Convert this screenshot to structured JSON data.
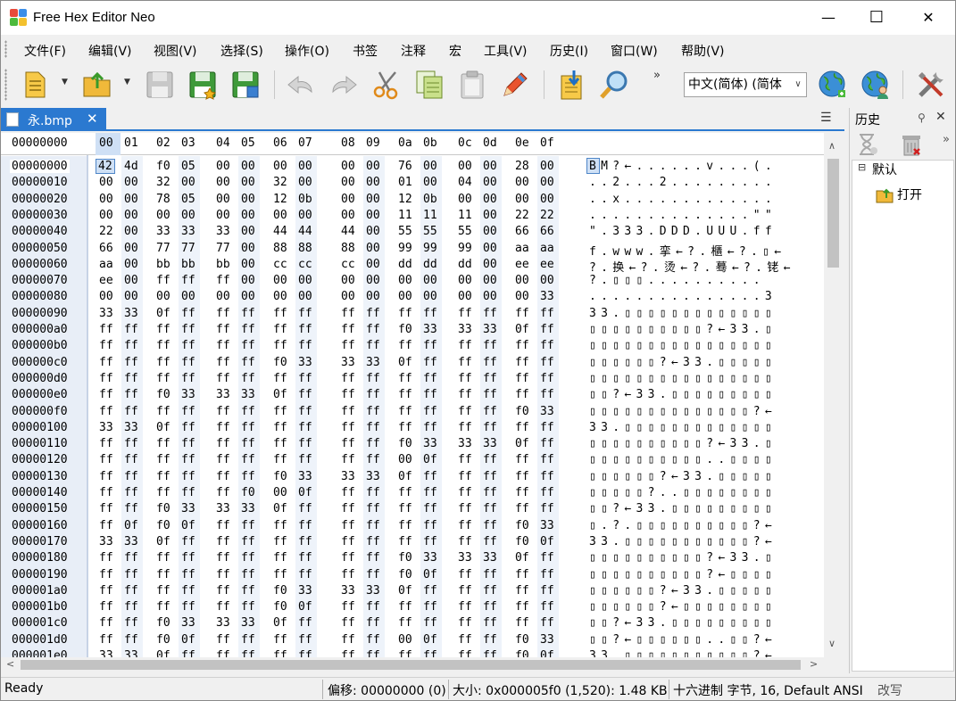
{
  "window": {
    "title": "Free Hex Editor Neo",
    "minimize": "—",
    "maximize": "☐",
    "close": "✕"
  },
  "menu": [
    "文件(F)",
    "编辑(V)",
    "视图(V)",
    "选择(S)",
    "操作(O)",
    "书签",
    "注释",
    "宏",
    "工具(V)",
    "历史(I)",
    "窗口(W)",
    "帮助(V)"
  ],
  "toolbar": {
    "icons": [
      "new-file-icon",
      "open-folder-icon",
      "save-disabled-icon",
      "save-as-icon",
      "save-all-icon",
      "undo-icon",
      "redo-icon",
      "cut-icon",
      "copy-icon",
      "paste-icon",
      "edit-icon",
      "import-icon",
      "find-icon",
      "globe-icon",
      "globe-user-icon",
      "tools-icon"
    ],
    "language": "中文(简体) (简体",
    "overflow": "»"
  },
  "tab": {
    "filename": "永.bmp",
    "close": "✕",
    "menu": "☰"
  },
  "hex": {
    "header_offset": "00000000",
    "columns": [
      "00",
      "01",
      "02",
      "03",
      "04",
      "05",
      "06",
      "07",
      "08",
      "09",
      "0a",
      "0b",
      "0c",
      "0d",
      "0e",
      "0f"
    ],
    "rows": [
      {
        "offset": "00000000",
        "bytes": [
          "42",
          "4d",
          "f0",
          "05",
          "00",
          "00",
          "00",
          "00",
          "00",
          "00",
          "76",
          "00",
          "00",
          "00",
          "28",
          "00"
        ],
        "text": "BM?←......v...(."
      },
      {
        "offset": "00000010",
        "bytes": [
          "00",
          "00",
          "32",
          "00",
          "00",
          "00",
          "32",
          "00",
          "00",
          "00",
          "01",
          "00",
          "04",
          "00",
          "00",
          "00"
        ],
        "text": "..2...2........."
      },
      {
        "offset": "00000020",
        "bytes": [
          "00",
          "00",
          "78",
          "05",
          "00",
          "00",
          "12",
          "0b",
          "00",
          "00",
          "12",
          "0b",
          "00",
          "00",
          "00",
          "00"
        ],
        "text": "..x............."
      },
      {
        "offset": "00000030",
        "bytes": [
          "00",
          "00",
          "00",
          "00",
          "00",
          "00",
          "00",
          "00",
          "00",
          "00",
          "11",
          "11",
          "11",
          "00",
          "22",
          "22"
        ],
        "text": "..............\"\""
      },
      {
        "offset": "00000040",
        "bytes": [
          "22",
          "00",
          "33",
          "33",
          "33",
          "00",
          "44",
          "44",
          "44",
          "00",
          "55",
          "55",
          "55",
          "00",
          "66",
          "66"
        ],
        "text": "\".333.DDD.UUU.ff"
      },
      {
        "offset": "00000050",
        "bytes": [
          "66",
          "00",
          "77",
          "77",
          "77",
          "00",
          "88",
          "88",
          "88",
          "00",
          "99",
          "99",
          "99",
          "00",
          "aa",
          "aa"
        ],
        "text": "f.www.挛←?.櫃←?.▯←"
      },
      {
        "offset": "00000060",
        "bytes": [
          "aa",
          "00",
          "bb",
          "bb",
          "bb",
          "00",
          "cc",
          "cc",
          "cc",
          "00",
          "dd",
          "dd",
          "dd",
          "00",
          "ee",
          "ee"
        ],
        "text": "?.换←?.烫←?.蓦←?.铑←"
      },
      {
        "offset": "00000070",
        "bytes": [
          "ee",
          "00",
          "ff",
          "ff",
          "ff",
          "00",
          "00",
          "00",
          "00",
          "00",
          "00",
          "00",
          "00",
          "00",
          "00",
          "00"
        ],
        "text": "?.▯▯▯.........."
      },
      {
        "offset": "00000080",
        "bytes": [
          "00",
          "00",
          "00",
          "00",
          "00",
          "00",
          "00",
          "00",
          "00",
          "00",
          "00",
          "00",
          "00",
          "00",
          "00",
          "33"
        ],
        "text": "...............3"
      },
      {
        "offset": "00000090",
        "bytes": [
          "33",
          "33",
          "0f",
          "ff",
          "ff",
          "ff",
          "ff",
          "ff",
          "ff",
          "ff",
          "ff",
          "ff",
          "ff",
          "ff",
          "ff",
          "ff"
        ],
        "text": "33.▯▯▯▯▯▯▯▯▯▯▯▯▯"
      },
      {
        "offset": "000000a0",
        "bytes": [
          "ff",
          "ff",
          "ff",
          "ff",
          "ff",
          "ff",
          "ff",
          "ff",
          "ff",
          "ff",
          "f0",
          "33",
          "33",
          "33",
          "0f",
          "ff"
        ],
        "text": "▯▯▯▯▯▯▯▯▯▯?←33.▯"
      },
      {
        "offset": "000000b0",
        "bytes": [
          "ff",
          "ff",
          "ff",
          "ff",
          "ff",
          "ff",
          "ff",
          "ff",
          "ff",
          "ff",
          "ff",
          "ff",
          "ff",
          "ff",
          "ff",
          "ff"
        ],
        "text": "▯▯▯▯▯▯▯▯▯▯▯▯▯▯▯▯"
      },
      {
        "offset": "000000c0",
        "bytes": [
          "ff",
          "ff",
          "ff",
          "ff",
          "ff",
          "ff",
          "f0",
          "33",
          "33",
          "33",
          "0f",
          "ff",
          "ff",
          "ff",
          "ff",
          "ff"
        ],
        "text": "▯▯▯▯▯▯?←33.▯▯▯▯▯"
      },
      {
        "offset": "000000d0",
        "bytes": [
          "ff",
          "ff",
          "ff",
          "ff",
          "ff",
          "ff",
          "ff",
          "ff",
          "ff",
          "ff",
          "ff",
          "ff",
          "ff",
          "ff",
          "ff",
          "ff"
        ],
        "text": "▯▯▯▯▯▯▯▯▯▯▯▯▯▯▯▯"
      },
      {
        "offset": "000000e0",
        "bytes": [
          "ff",
          "ff",
          "f0",
          "33",
          "33",
          "33",
          "0f",
          "ff",
          "ff",
          "ff",
          "ff",
          "ff",
          "ff",
          "ff",
          "ff",
          "ff"
        ],
        "text": "▯▯?←33.▯▯▯▯▯▯▯▯▯"
      },
      {
        "offset": "000000f0",
        "bytes": [
          "ff",
          "ff",
          "ff",
          "ff",
          "ff",
          "ff",
          "ff",
          "ff",
          "ff",
          "ff",
          "ff",
          "ff",
          "ff",
          "ff",
          "f0",
          "33"
        ],
        "text": "▯▯▯▯▯▯▯▯▯▯▯▯▯▯?←"
      },
      {
        "offset": "00000100",
        "bytes": [
          "33",
          "33",
          "0f",
          "ff",
          "ff",
          "ff",
          "ff",
          "ff",
          "ff",
          "ff",
          "ff",
          "ff",
          "ff",
          "ff",
          "ff",
          "ff"
        ],
        "text": "33.▯▯▯▯▯▯▯▯▯▯▯▯▯"
      },
      {
        "offset": "00000110",
        "bytes": [
          "ff",
          "ff",
          "ff",
          "ff",
          "ff",
          "ff",
          "ff",
          "ff",
          "ff",
          "ff",
          "f0",
          "33",
          "33",
          "33",
          "0f",
          "ff"
        ],
        "text": "▯▯▯▯▯▯▯▯▯▯?←33.▯"
      },
      {
        "offset": "00000120",
        "bytes": [
          "ff",
          "ff",
          "ff",
          "ff",
          "ff",
          "ff",
          "ff",
          "ff",
          "ff",
          "ff",
          "00",
          "0f",
          "ff",
          "ff",
          "ff",
          "ff"
        ],
        "text": "▯▯▯▯▯▯▯▯▯▯..▯▯▯▯"
      },
      {
        "offset": "00000130",
        "bytes": [
          "ff",
          "ff",
          "ff",
          "ff",
          "ff",
          "ff",
          "f0",
          "33",
          "33",
          "33",
          "0f",
          "ff",
          "ff",
          "ff",
          "ff",
          "ff"
        ],
        "text": "▯▯▯▯▯▯?←33.▯▯▯▯▯"
      },
      {
        "offset": "00000140",
        "bytes": [
          "ff",
          "ff",
          "ff",
          "ff",
          "ff",
          "f0",
          "00",
          "0f",
          "ff",
          "ff",
          "ff",
          "ff",
          "ff",
          "ff",
          "ff",
          "ff"
        ],
        "text": "▯▯▯▯▯?..▯▯▯▯▯▯▯▯"
      },
      {
        "offset": "00000150",
        "bytes": [
          "ff",
          "ff",
          "f0",
          "33",
          "33",
          "33",
          "0f",
          "ff",
          "ff",
          "ff",
          "ff",
          "ff",
          "ff",
          "ff",
          "ff",
          "ff"
        ],
        "text": "▯▯?←33.▯▯▯▯▯▯▯▯▯"
      },
      {
        "offset": "00000160",
        "bytes": [
          "ff",
          "0f",
          "f0",
          "0f",
          "ff",
          "ff",
          "ff",
          "ff",
          "ff",
          "ff",
          "ff",
          "ff",
          "ff",
          "ff",
          "f0",
          "33"
        ],
        "text": "▯.?.▯▯▯▯▯▯▯▯▯▯?←"
      },
      {
        "offset": "00000170",
        "bytes": [
          "33",
          "33",
          "0f",
          "ff",
          "ff",
          "ff",
          "ff",
          "ff",
          "ff",
          "ff",
          "ff",
          "ff",
          "ff",
          "ff",
          "f0",
          "0f"
        ],
        "text": "33.▯▯▯▯▯▯▯▯▯▯▯?←"
      },
      {
        "offset": "00000180",
        "bytes": [
          "ff",
          "ff",
          "ff",
          "ff",
          "ff",
          "ff",
          "ff",
          "ff",
          "ff",
          "ff",
          "f0",
          "33",
          "33",
          "33",
          "0f",
          "ff"
        ],
        "text": "▯▯▯▯▯▯▯▯▯▯?←33.▯"
      },
      {
        "offset": "00000190",
        "bytes": [
          "ff",
          "ff",
          "ff",
          "ff",
          "ff",
          "ff",
          "ff",
          "ff",
          "ff",
          "ff",
          "f0",
          "0f",
          "ff",
          "ff",
          "ff",
          "ff"
        ],
        "text": "▯▯▯▯▯▯▯▯▯▯?←▯▯▯▯"
      },
      {
        "offset": "000001a0",
        "bytes": [
          "ff",
          "ff",
          "ff",
          "ff",
          "ff",
          "ff",
          "f0",
          "33",
          "33",
          "33",
          "0f",
          "ff",
          "ff",
          "ff",
          "ff",
          "ff"
        ],
        "text": "▯▯▯▯▯▯?←33.▯▯▯▯▯"
      },
      {
        "offset": "000001b0",
        "bytes": [
          "ff",
          "ff",
          "ff",
          "ff",
          "ff",
          "ff",
          "f0",
          "0f",
          "ff",
          "ff",
          "ff",
          "ff",
          "ff",
          "ff",
          "ff",
          "ff"
        ],
        "text": "▯▯▯▯▯▯?←▯▯▯▯▯▯▯▯"
      },
      {
        "offset": "000001c0",
        "bytes": [
          "ff",
          "ff",
          "f0",
          "33",
          "33",
          "33",
          "0f",
          "ff",
          "ff",
          "ff",
          "ff",
          "ff",
          "ff",
          "ff",
          "ff",
          "ff"
        ],
        "text": "▯▯?←33.▯▯▯▯▯▯▯▯▯"
      },
      {
        "offset": "000001d0",
        "bytes": [
          "ff",
          "ff",
          "f0",
          "0f",
          "ff",
          "ff",
          "ff",
          "ff",
          "ff",
          "ff",
          "00",
          "0f",
          "ff",
          "ff",
          "f0",
          "33"
        ],
        "text": "▯▯?←▯▯▯▯▯▯..▯▯?←"
      },
      {
        "offset": "000001e0",
        "bytes": [
          "33",
          "33",
          "0f",
          "ff",
          "ff",
          "ff",
          "ff",
          "ff",
          "ff",
          "ff",
          "ff",
          "ff",
          "ff",
          "ff",
          "f0",
          "0f"
        ],
        "text": "33.▯▯▯▯▯▯▯▯▯▯▯?←"
      }
    ]
  },
  "history": {
    "title": "历史",
    "pin": "📌",
    "close": "✕",
    "icons": [
      "hourglass-icon",
      "delete-icon"
    ],
    "overflow": "»",
    "tree": {
      "root": "默认",
      "child": "打开"
    }
  },
  "status": {
    "ready": "Ready",
    "offset": "偏移: 00000000 (0)",
    "size": "大小: 0x000005f0 (1,520): 1.48 KB",
    "mode": "十六进制 字节, 16, Default ANSI",
    "overwrite": "改写"
  },
  "colors": {
    "accent": "#2b79d0",
    "offset_bg": "#e8eef7",
    "selection": "#cfe0f5"
  }
}
